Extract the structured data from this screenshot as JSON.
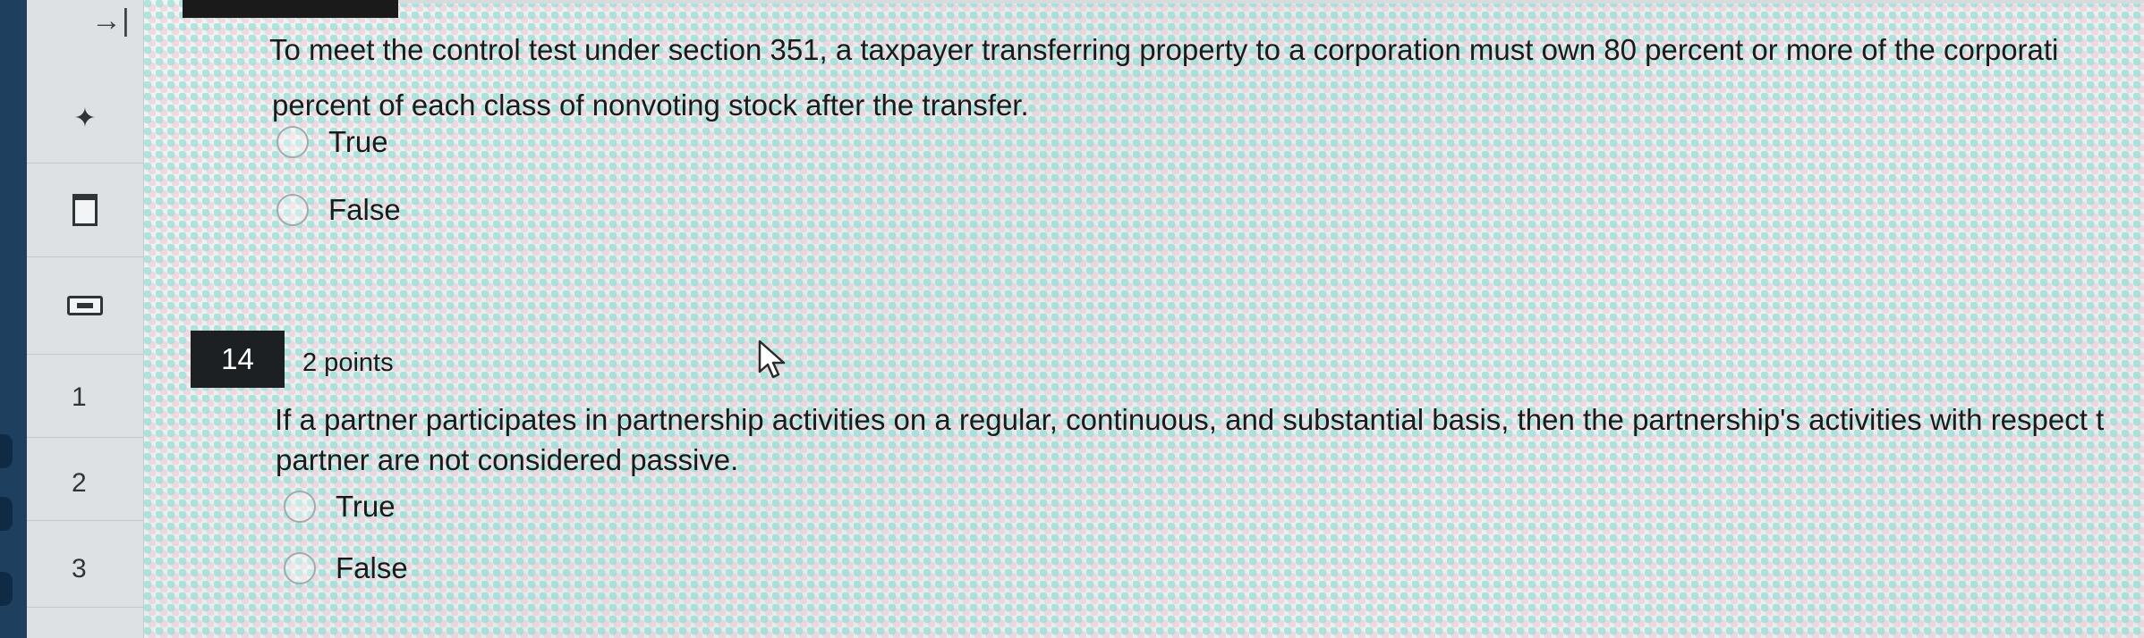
{
  "sidebar": {
    "expand_icon": "→|",
    "pin_icon": "✦",
    "icons": [
      "expand-icon",
      "pin-icon",
      "bookmark-icon",
      "calculator-icon"
    ],
    "questions": [
      "1",
      "2",
      "3"
    ]
  },
  "question13": {
    "text_line1": "To meet the control test under section 351, a taxpayer transferring property to a corporation must own 80 percent or more of the corporati",
    "text_line2": "percent of each class of nonvoting stock after the transfer.",
    "options": [
      "True",
      "False"
    ]
  },
  "question14": {
    "number": "14",
    "points": "2 points",
    "text_line1": "If a partner participates in partnership activities on a regular, continuous, and substantial basis, then the partnership's activities with respect t",
    "text_line2": "partner are not considered passive.",
    "options": [
      "True",
      "False"
    ]
  },
  "colors": {
    "sidebar_bg": "#dde1e3",
    "edge_strip": "#1f3f5e",
    "badge_bg": "#1d2023"
  }
}
